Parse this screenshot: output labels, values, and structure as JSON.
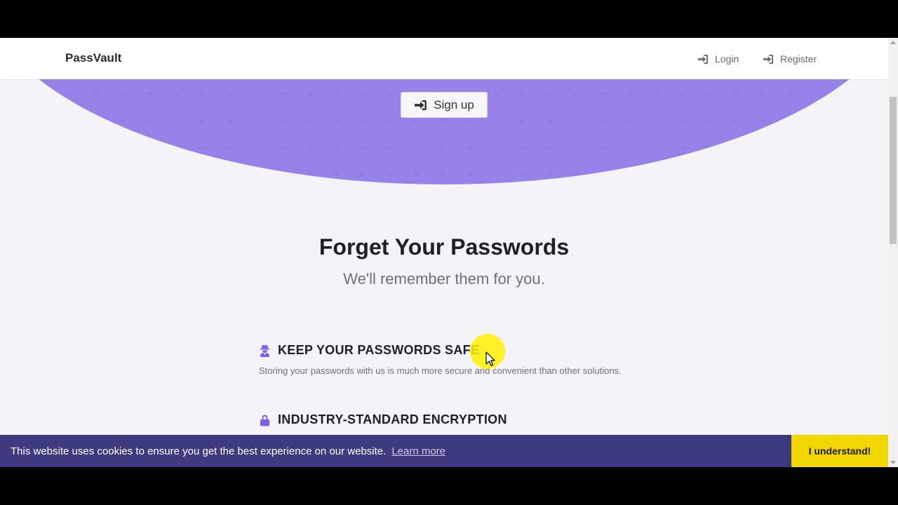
{
  "navbar": {
    "brand": "PassVault",
    "login_label": "Login",
    "register_label": "Register"
  },
  "hero": {
    "signup_label": "Sign up"
  },
  "main": {
    "headline": "Forget Your Passwords",
    "subline": "We'll remember them for you.",
    "features": [
      {
        "icon": "user-secret-icon",
        "title": "KEEP YOUR PASSWORDS SAFE",
        "description": "Storing your passwords with us is much more secure and convenient than other solutions."
      },
      {
        "icon": "lock-icon",
        "title": "INDUSTRY-STANDARD ENCRYPTION",
        "description": ""
      }
    ]
  },
  "cookie_banner": {
    "message": "This website uses cookies to ensure you get the best experience on our website.",
    "learn_more": "Learn more",
    "accept_label": "I understand!"
  },
  "colors": {
    "accent": "#7d60e6",
    "hero": "#9782ea",
    "cookie_bar": "#3e3a7f",
    "cookie_button": "#f2d600"
  }
}
